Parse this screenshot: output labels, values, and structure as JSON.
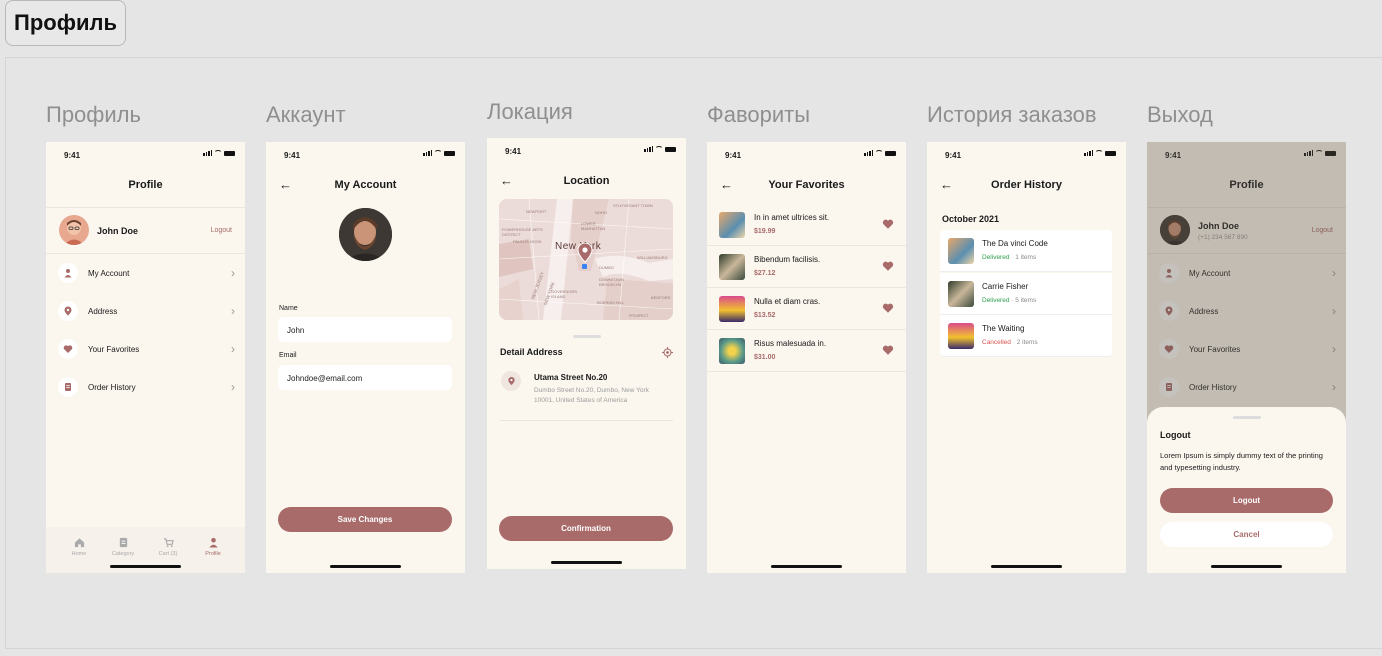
{
  "page_tab": "Профиль",
  "frames": {
    "profile": "Профиль",
    "account": "Аккаунт",
    "location": "Локация",
    "favorites": "Фавориты",
    "history": "История заказов",
    "logout": "Выход"
  },
  "status_time": "9:41",
  "profile": {
    "title": "Profile",
    "user_name": "John Doe",
    "logout_link": "Logout",
    "menu": [
      {
        "label": "My Account",
        "icon": "user-icon"
      },
      {
        "label": "Address",
        "icon": "location-pin-icon"
      },
      {
        "label": "Your Favorites",
        "icon": "heart-icon"
      },
      {
        "label": "Order History",
        "icon": "receipt-icon"
      }
    ],
    "nav": [
      {
        "label": "Home",
        "icon": "home-icon"
      },
      {
        "label": "Category",
        "icon": "category-icon"
      },
      {
        "label": "Cart (3)",
        "icon": "cart-icon"
      },
      {
        "label": "Profile",
        "icon": "profile-icon"
      }
    ]
  },
  "account": {
    "title": "My Account",
    "name_label": "Name",
    "name_value": "John",
    "email_label": "Email",
    "email_value": "Johndoe@email.com",
    "save_button": "Save Changes"
  },
  "location": {
    "title": "Location",
    "map_city_label": "New York",
    "map_labels": [
      "NEWPORT",
      "NOHO",
      "STUYVESANT TOWN",
      "LOWER MANHATTAN",
      "POWERHOUSE ARTS DISTRICT",
      "PAULUS HOOK",
      "NEW JERSEY",
      "NEW YORK",
      "DUMBO",
      "DOWNTOWN BROOKLYN",
      "WILLIAMSBURG",
      "GOVERNORS ISLAND",
      "BOERUM HILL",
      "BEDFORD",
      "PROSPECT"
    ],
    "detail_title": "Detail Address",
    "street": "Utama Street No.20",
    "address_line": "Dumbo Street No.20, Dumbo, New York 10001, United States of America",
    "confirm_button": "Confirmation"
  },
  "favorites": {
    "title": "Your Favorites",
    "items": [
      {
        "title": "In in amet ultrices sit.",
        "price": "$19.99"
      },
      {
        "title": "Bibendum facilisis.",
        "price": "$27.12"
      },
      {
        "title": "Nulla et diam cras.",
        "price": "$13.52"
      },
      {
        "title": "Risus malesuada in.",
        "price": "$31.00"
      }
    ]
  },
  "history": {
    "title": "Order History",
    "month": "October 2021",
    "orders": [
      {
        "title": "The Da vinci Code",
        "status": "Delivered",
        "items": "1 items"
      },
      {
        "title": "Carrie Fisher",
        "status": "Delivered",
        "items": "5 items"
      },
      {
        "title": "The Waiting",
        "status": "Cancelled",
        "items": "2 items"
      }
    ],
    "separator": "·"
  },
  "logout": {
    "title": "Profile",
    "user_name": "John Doe",
    "phone": "(+1) 234 567 890",
    "logout_link": "Logout",
    "menu": [
      "My Account",
      "Address",
      "Your Favorites",
      "Order History"
    ],
    "sheet_title": "Logout",
    "sheet_text": "Lorem Ipsum is simply dummy text of the printing and typesetting industry.",
    "confirm_button": "Logout",
    "cancel_button": "Cancel"
  },
  "colors": {
    "accent": "#a86b6a",
    "background": "#fbf6ee",
    "delivered": "#2e9e4f",
    "cancelled": "#d9534f"
  }
}
